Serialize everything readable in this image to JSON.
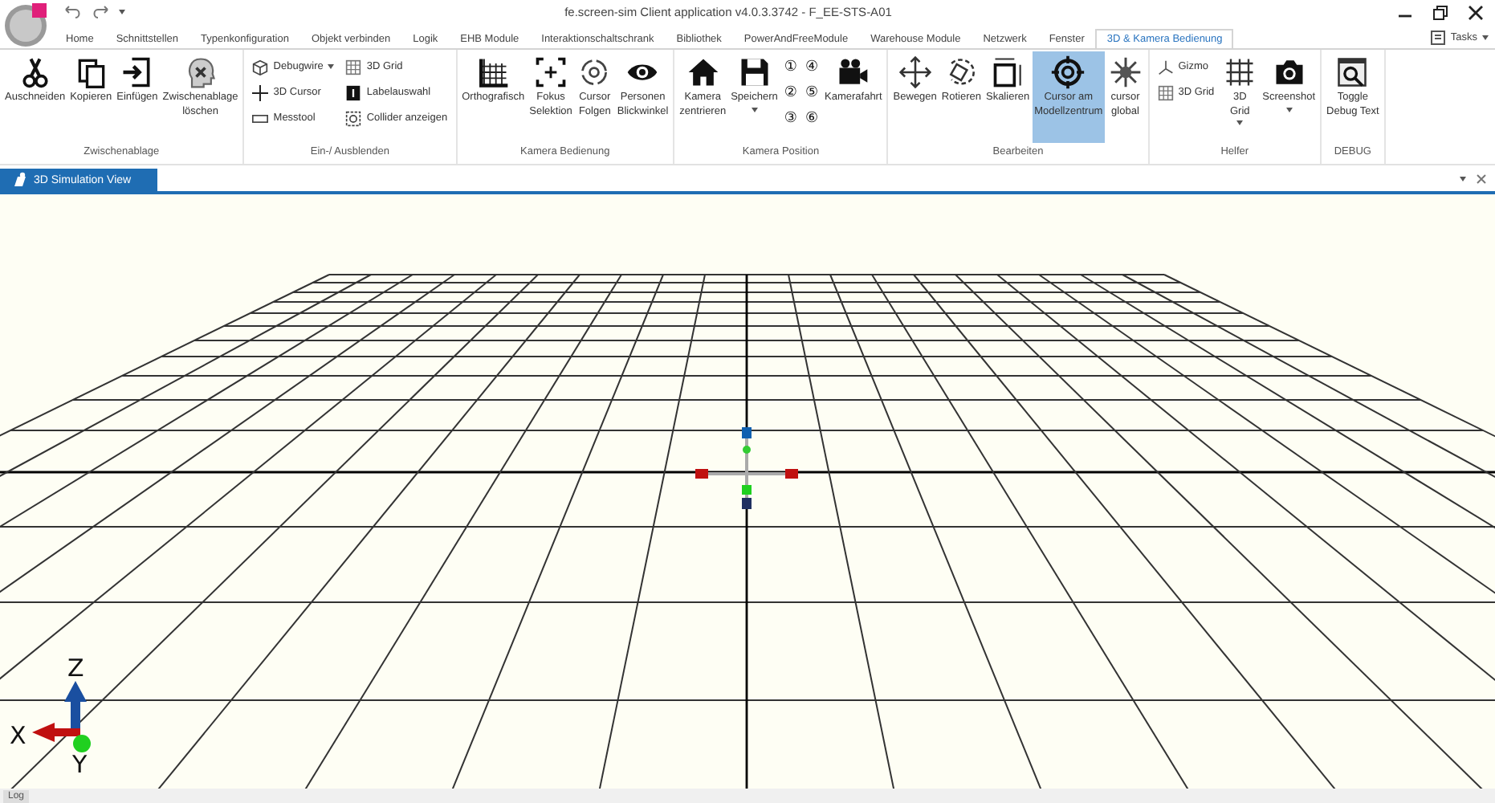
{
  "window": {
    "title": "fe.screen-sim Client application v4.0.3.3742 - F_EE-STS-A01"
  },
  "tabs": [
    {
      "label": "Home",
      "selected": false
    },
    {
      "label": "Schnittstellen",
      "selected": false
    },
    {
      "label": "Typenkonfiguration",
      "selected": false
    },
    {
      "label": "Objekt verbinden",
      "selected": false
    },
    {
      "label": "Logik",
      "selected": false
    },
    {
      "label": "EHB Module",
      "selected": false
    },
    {
      "label": "Interaktionschaltschrank",
      "selected": false
    },
    {
      "label": "Bibliothek",
      "selected": false
    },
    {
      "label": "PowerAndFreeModule",
      "selected": false
    },
    {
      "label": "Warehouse Module",
      "selected": false
    },
    {
      "label": "Netzwerk",
      "selected": false
    },
    {
      "label": "Fenster",
      "selected": false
    },
    {
      "label": "3D & Kamera Bedienung",
      "selected": true
    }
  ],
  "tasks": {
    "label": "Tasks"
  },
  "ribbon_groups": [
    {
      "label": "Zwischenablage",
      "items": [
        {
          "kind": "large",
          "label": "Auschneiden",
          "selected": false
        },
        {
          "kind": "large",
          "label": "Kopieren",
          "selected": false
        },
        {
          "kind": "large",
          "label": "Einfügen",
          "selected": false
        },
        {
          "kind": "large",
          "label": "Zwischenablage\nlöschen",
          "selected": false
        }
      ]
    },
    {
      "label": "Ein-/ Ausblenden",
      "items": [
        {
          "kind": "column",
          "items": [
            {
              "label": "Debugwire",
              "dropdown": true
            },
            {
              "label": "3D Cursor"
            },
            {
              "label": "Messtool"
            }
          ]
        },
        {
          "kind": "column",
          "items": [
            {
              "label": "3D Grid"
            },
            {
              "label": "Labelauswahl"
            },
            {
              "label": "Collider anzeigen"
            }
          ]
        }
      ]
    },
    {
      "label": "Kamera Bedienung",
      "items": [
        {
          "kind": "large",
          "label": "Orthografisch",
          "selected": false
        },
        {
          "kind": "large",
          "label": "Fokus\nSelektion",
          "selected": false
        },
        {
          "kind": "large",
          "label": "Cursor\nFolgen",
          "selected": false
        },
        {
          "kind": "large",
          "label": "Personen\nBlickwinkel",
          "selected": false
        }
      ]
    },
    {
      "label": "Kamera Position",
      "items": [
        {
          "kind": "large",
          "label": "Kamera\nzentrieren",
          "selected": false
        },
        {
          "kind": "large",
          "label": "Speichern",
          "selected": false,
          "dropdown": true
        },
        {
          "kind": "column",
          "items": [
            {
              "label": "①"
            },
            {
              "label": "②"
            },
            {
              "label": "③"
            }
          ]
        },
        {
          "kind": "column",
          "items": [
            {
              "label": "④"
            },
            {
              "label": "⑤"
            },
            {
              "label": "⑥"
            }
          ]
        },
        {
          "kind": "large",
          "label": "Kamerafahrt",
          "selected": false
        }
      ]
    },
    {
      "label": "Bearbeiten",
      "items": [
        {
          "kind": "large",
          "label": "Bewegen",
          "selected": false
        },
        {
          "kind": "large",
          "label": "Rotieren",
          "selected": false
        },
        {
          "kind": "large",
          "label": "Skalieren",
          "selected": false
        },
        {
          "kind": "large",
          "label": "Cursor am\nModellzentrum",
          "selected": true
        },
        {
          "kind": "large",
          "label": "cursor\nglobal",
          "selected": false
        }
      ]
    },
    {
      "label": "Helfer",
      "items": [
        {
          "kind": "column",
          "items": [
            {
              "label": "Gizmo"
            },
            {
              "label": "3D Grid"
            }
          ]
        },
        {
          "kind": "large",
          "label": "3D\nGrid",
          "selected": false,
          "dropdown": true
        },
        {
          "kind": "large",
          "label": "Screenshot",
          "selected": false,
          "dropdown": true
        }
      ]
    },
    {
      "label": "DEBUG",
      "items": [
        {
          "kind": "large",
          "label": "Toggle\nDebug Text",
          "selected": false
        }
      ]
    }
  ],
  "document_tab": {
    "label": "3D Simulation View"
  },
  "viewport": {
    "axes": {
      "x": "X",
      "y": "Y",
      "z": "Z"
    }
  },
  "status_bar": {
    "log_tab": "Log"
  }
}
